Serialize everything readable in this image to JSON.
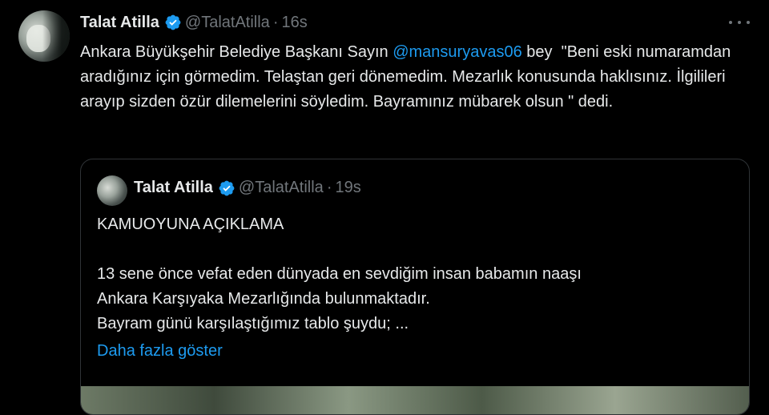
{
  "tweet": {
    "author_name": "Talat Atilla",
    "handle": "@TalatAtilla",
    "separator": "·",
    "time": "16s",
    "text_before_mention": "Ankara Büyükşehir Belediye Başkanı Sayın ",
    "mention": "@mansuryavas06",
    "text_after_mention": " bey  \"Beni eski numaramdan aradığınız için görmedim. Telaştan geri dönemedim. Mezarlık konusunda haklısınız. İlgilileri arayıp sizden özür dilemelerini söyledim. Bayramınız mübarek olsun \" dedi."
  },
  "quote": {
    "author_name": "Talat Atilla",
    "handle": "@TalatAtilla",
    "separator": "·",
    "time": "19s",
    "text": "KAMUOYUNA AÇIKLAMA\n\n13 sene önce vefat eden dünyada en sevdiğim insan babamın naaşı\nAnkara Karşıyaka Mezarlığında bulunmaktadır.\nBayram günü karşılaştığımız tablo şuydu; ...",
    "show_more": "Daha fazla göster"
  },
  "icons": {
    "verified": "verified-badge-icon",
    "more": "more-options-icon"
  },
  "colors": {
    "accent": "#1d9bf0",
    "text_primary": "#e7e9ea",
    "text_secondary": "#71767b",
    "background": "#000000",
    "border": "#2f3336"
  }
}
